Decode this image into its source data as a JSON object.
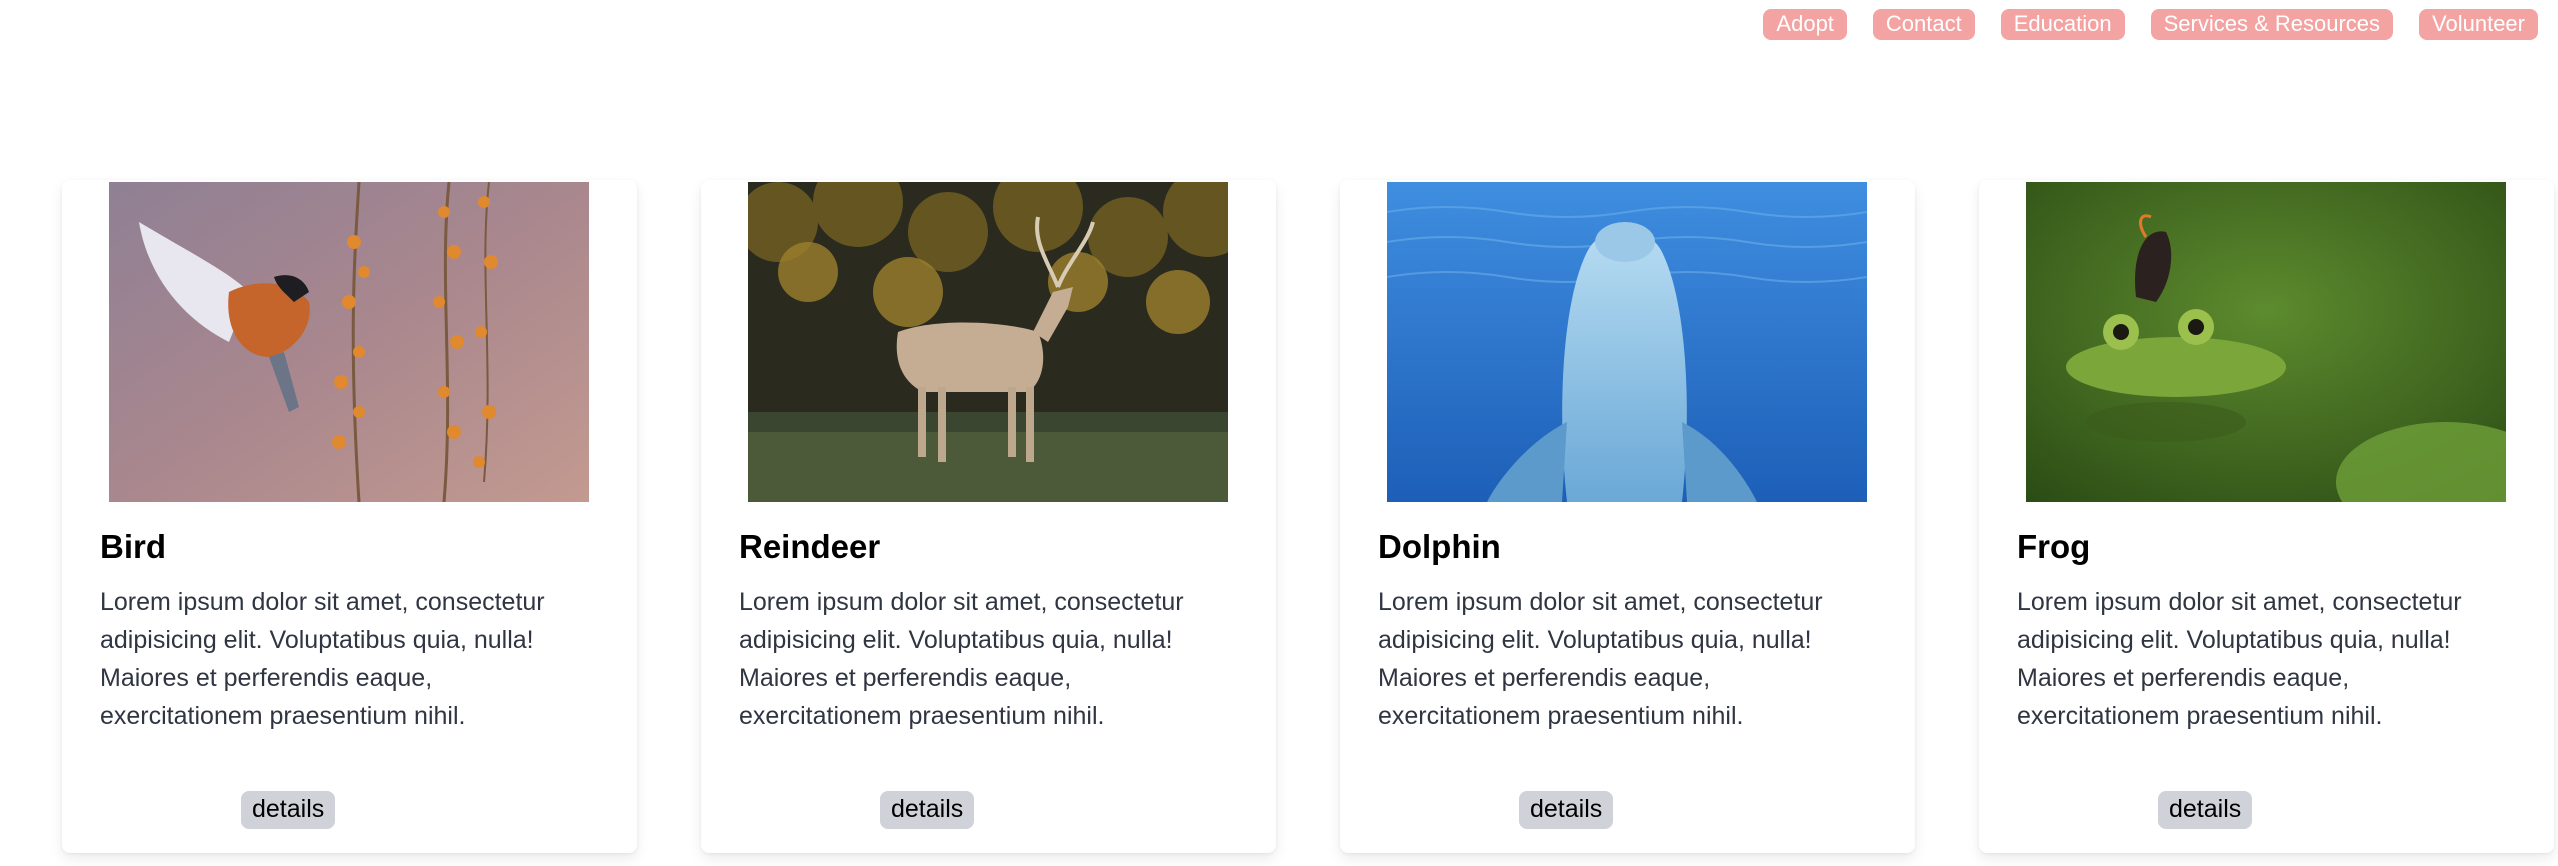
{
  "nav": {
    "items": [
      {
        "label": "Adopt"
      },
      {
        "label": "Contact"
      },
      {
        "label": "Education"
      },
      {
        "label": "Services & Resources"
      },
      {
        "label": "Volunteer"
      }
    ]
  },
  "cards": [
    {
      "title": "Bird",
      "image_icon": "bird-photo",
      "text": "Lorem ipsum dolor sit amet, consectetur adipisicing elit. Voluptatibus quia, nulla! Maiores et perferendis eaque, exercitationem praesentium nihil.",
      "button_label": "details"
    },
    {
      "title": "Reindeer",
      "image_icon": "reindeer-photo",
      "text": "Lorem ipsum dolor sit amet, consectetur adipisicing elit. Voluptatibus quia, nulla! Maiores et perferendis eaque, exercitationem praesentium nihil.",
      "button_label": "details"
    },
    {
      "title": "Dolphin",
      "image_icon": "dolphin-photo",
      "text": "Lorem ipsum dolor sit amet, consectetur adipisicing elit. Voluptatibus quia, nulla! Maiores et perferendis eaque, exercitationem praesentium nihil.",
      "button_label": "details"
    },
    {
      "title": "Frog",
      "image_icon": "frog-photo",
      "text": "Lorem ipsum dolor sit amet, consectetur adipisicing elit. Voluptatibus quia, nulla! Maiores et perferendis eaque, exercitationem praesentium nihil.",
      "button_label": "details"
    }
  ],
  "colors": {
    "nav_pill_bg": "#f4a3a3",
    "nav_pill_text": "#ffffff",
    "button_bg": "#cfd2d8",
    "body_text": "#2f3541"
  }
}
